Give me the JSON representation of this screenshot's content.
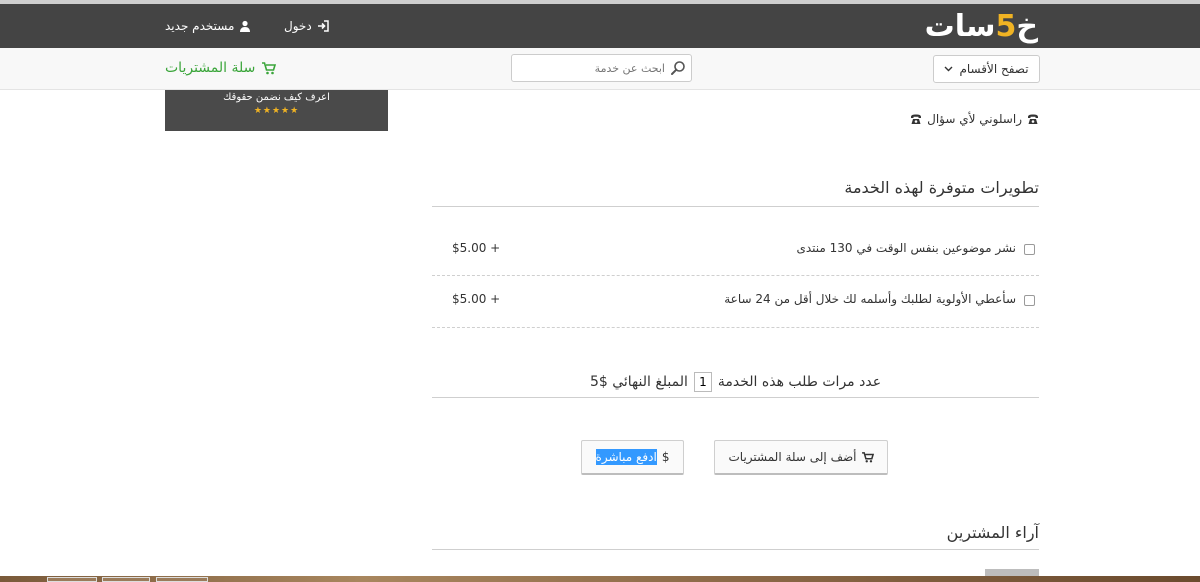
{
  "header": {
    "logo_main": "خمسات",
    "logo_text_before": "خ",
    "logo_five": "5",
    "logo_text_after": "سات",
    "login_label": "دخول",
    "register_label": "مستخدم جديد"
  },
  "subbar": {
    "browse_label": "تصفح الأقسام",
    "search_placeholder": "ابحث عن خدمة",
    "cart_label": "سلة المشتريات"
  },
  "banner": {
    "text": "اعرف كيف نضمن حقوقك",
    "stars": "★★★★★"
  },
  "contact": {
    "label": "راسلوني لأي سؤال"
  },
  "upgrades": {
    "title": "تطويرات متوفرة لهذه الخدمة",
    "items": [
      {
        "label": "نشر موضوعين بنفس الوقت في 130 منتدى",
        "price": "$5.00 +"
      },
      {
        "label": "سأعطي الأولوية لطلبك وأسلمه لك خلال أقل من 24 ساعة",
        "price": "$5.00 +"
      }
    ]
  },
  "order": {
    "count_prefix": "عدد مرات طلب هذه الخدمة",
    "count_value": "1",
    "total_label": "المبلغ النهائي $5"
  },
  "actions": {
    "add_to_cart": "أضف إلى سلة المشتريات",
    "pay_now": "ادفع مباشرة",
    "pay_symbol": "$"
  },
  "reviews": {
    "title": "آراء المشترين"
  },
  "colors": {
    "topbar": "#444444",
    "accent": "#f0b323",
    "cart_green": "#3aa53a",
    "selection_blue": "#3399ff"
  }
}
